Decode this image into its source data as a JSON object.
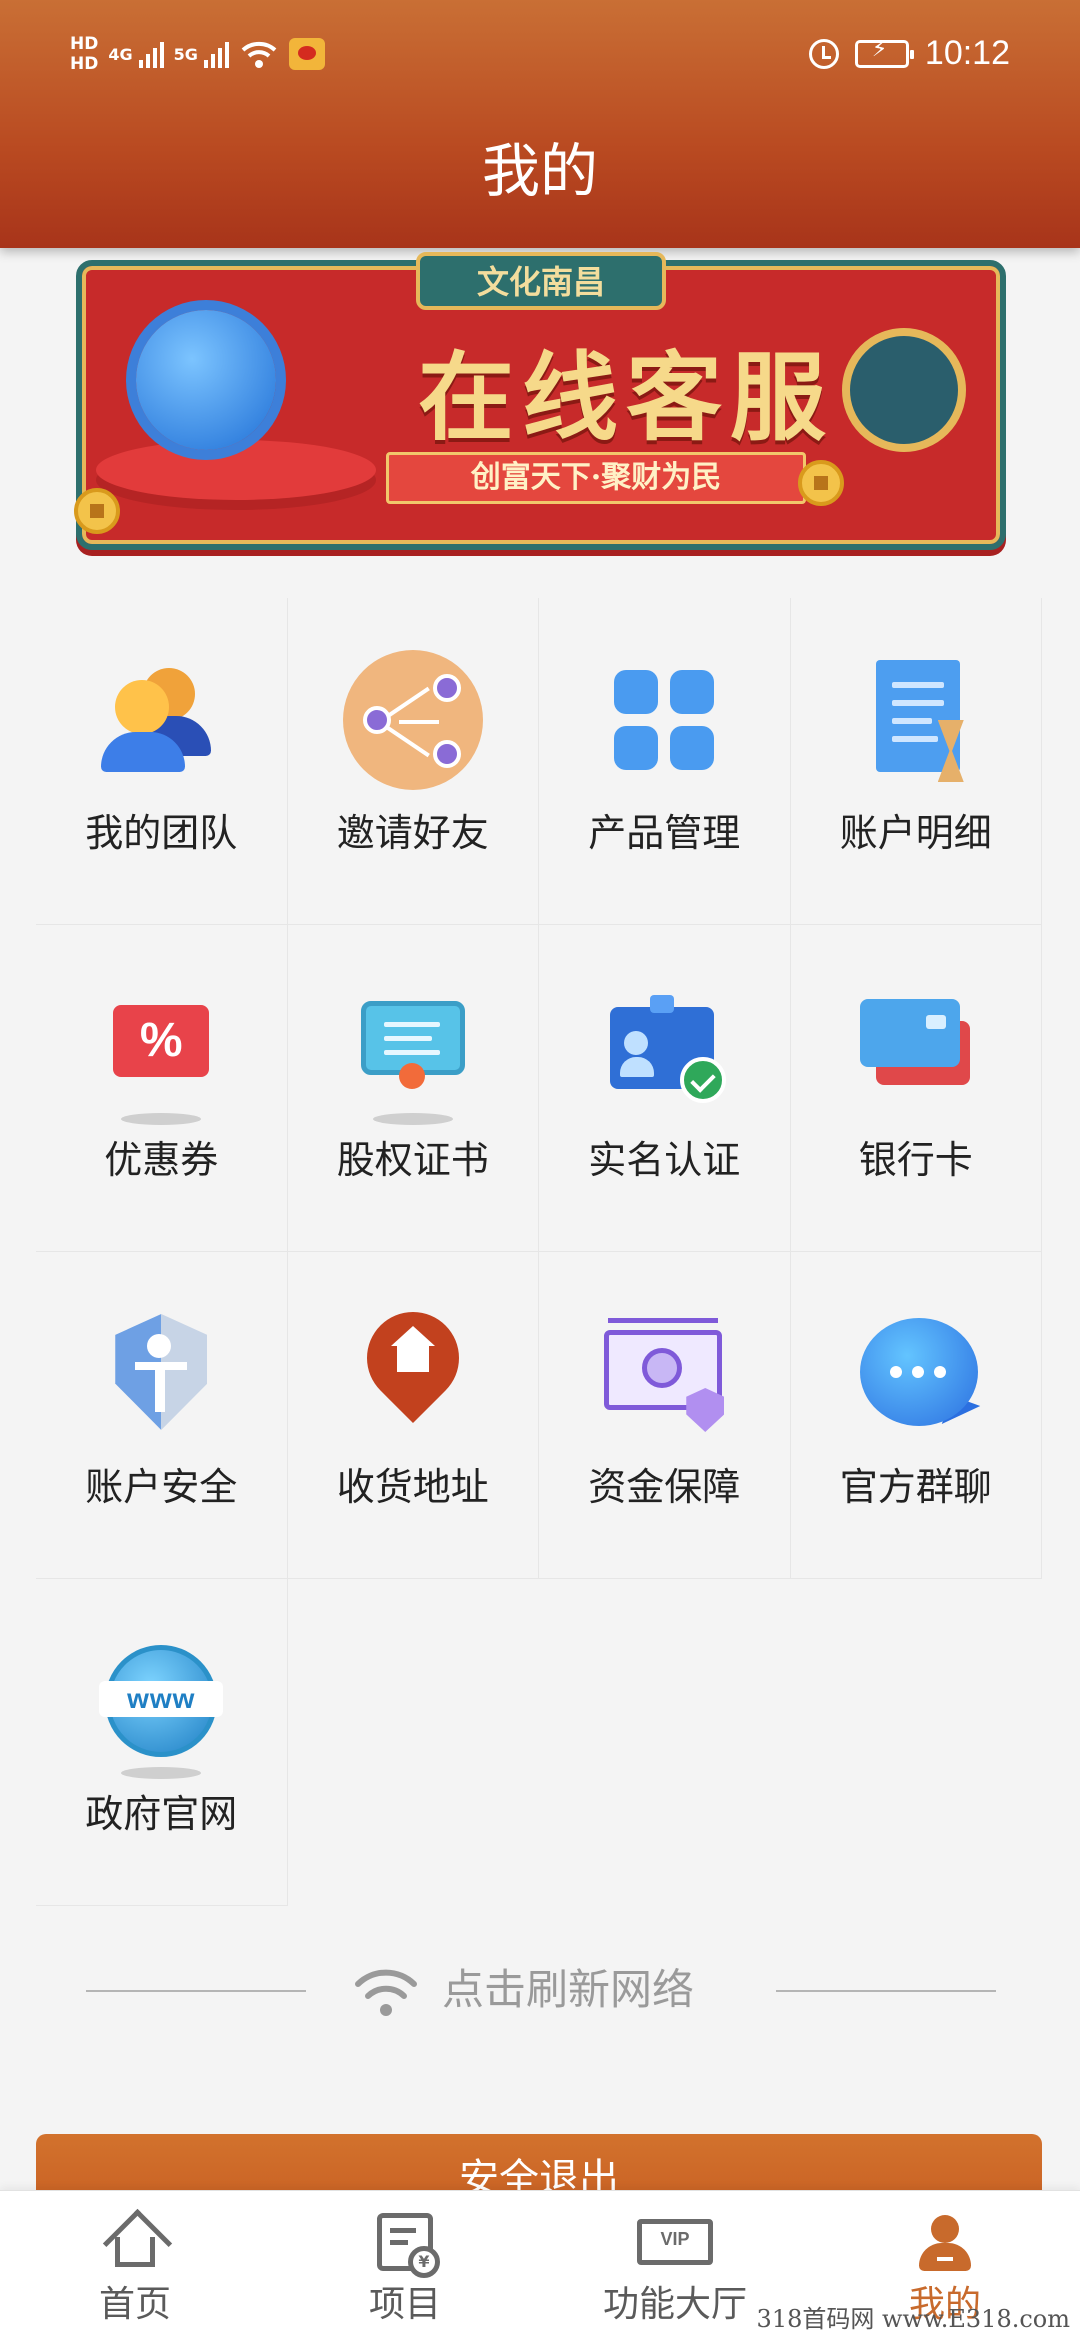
{
  "status_bar": {
    "hd1": "HD",
    "hd2": "HD",
    "net1": "4G",
    "net2": "5G",
    "time": "10:12"
  },
  "header": {
    "title": "我的"
  },
  "banner": {
    "tag": "文化南昌",
    "title": "在线客服",
    "subtitle": "创富天下·聚财为民"
  },
  "grid": {
    "items": [
      {
        "label": "我的团队",
        "icon": "team-icon"
      },
      {
        "label": "邀请好友",
        "icon": "invite-icon"
      },
      {
        "label": "产品管理",
        "icon": "product-grid-icon"
      },
      {
        "label": "账户明细",
        "icon": "account-detail-icon"
      },
      {
        "label": "优惠券",
        "icon": "coupon-icon"
      },
      {
        "label": "股权证书",
        "icon": "certificate-icon"
      },
      {
        "label": "实名认证",
        "icon": "id-verify-icon"
      },
      {
        "label": "银行卡",
        "icon": "bank-card-icon"
      },
      {
        "label": "账户安全",
        "icon": "shield-icon"
      },
      {
        "label": "收货地址",
        "icon": "address-pin-icon"
      },
      {
        "label": "资金保障",
        "icon": "fund-guarantee-icon"
      },
      {
        "label": "官方群聊",
        "icon": "chat-bubble-icon"
      },
      {
        "label": "政府官网",
        "icon": "www-globe-icon",
        "icon_text": "www"
      }
    ]
  },
  "refresh": {
    "label": "点击刷新网络"
  },
  "logout": {
    "label": "安全退出"
  },
  "tabbar": {
    "tabs": [
      {
        "label": "首页",
        "icon": "home-icon"
      },
      {
        "label": "项目",
        "icon": "project-icon"
      },
      {
        "label": "功能大厅",
        "icon": "vip-icon",
        "icon_text": "VIP"
      },
      {
        "label": "我的",
        "icon": "profile-icon",
        "active": true
      }
    ]
  },
  "watermark": "318首码网 www.E318.com",
  "colors": {
    "header": "#b94a21",
    "accent": "#c86a2c",
    "background": "#f4f4f4"
  }
}
